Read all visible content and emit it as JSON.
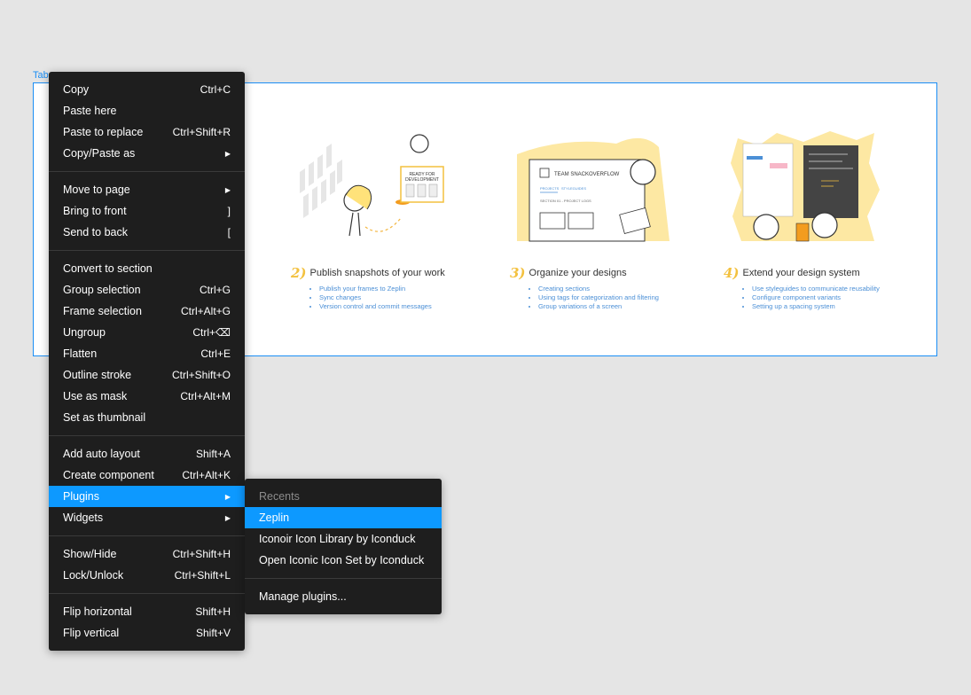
{
  "canvas": {
    "frame_label": "Tab",
    "columns": [
      {
        "num": "2)",
        "title": "Publish snapshots of your work",
        "bullets": [
          "Publish your frames to Zeplin",
          "Sync changes",
          "Version control and commit messages"
        ],
        "art_text": [
          "READY FOR",
          "DEVELOPMENT"
        ]
      },
      {
        "num": "3)",
        "title": "Organize your designs",
        "bullets": [
          "Creating sections",
          "Using tags for categorization and filtering",
          "Group variations of a screen"
        ],
        "art_text": [
          "TEAM SNACKOVERFLOW",
          "PROJECTS",
          "STYLEGUIDES",
          "SECTION 01 - PROJECT LOGS"
        ]
      },
      {
        "num": "4)",
        "title": "Extend your design system",
        "bullets": [
          "Use styleguides to communicate reusability",
          "Configure component variants",
          "Setting up a spacing system"
        ],
        "art_text": []
      }
    ]
  },
  "menu": {
    "groups": [
      [
        {
          "label": "Copy",
          "shortcut": "Ctrl+C"
        },
        {
          "label": "Paste here",
          "shortcut": ""
        },
        {
          "label": "Paste to replace",
          "shortcut": "Ctrl+Shift+R"
        },
        {
          "label": "Copy/Paste as",
          "shortcut": "",
          "submenu": true
        }
      ],
      [
        {
          "label": "Move to page",
          "shortcut": "",
          "submenu": true
        },
        {
          "label": "Bring to front",
          "shortcut": "]"
        },
        {
          "label": "Send to back",
          "shortcut": "["
        }
      ],
      [
        {
          "label": "Convert to section",
          "shortcut": ""
        },
        {
          "label": "Group selection",
          "shortcut": "Ctrl+G"
        },
        {
          "label": "Frame selection",
          "shortcut": "Ctrl+Alt+G"
        },
        {
          "label": "Ungroup",
          "shortcut": "Ctrl+⌫"
        },
        {
          "label": "Flatten",
          "shortcut": "Ctrl+E"
        },
        {
          "label": "Outline stroke",
          "shortcut": "Ctrl+Shift+O"
        },
        {
          "label": "Use as mask",
          "shortcut": "Ctrl+Alt+M"
        },
        {
          "label": "Set as thumbnail",
          "shortcut": ""
        }
      ],
      [
        {
          "label": "Add auto layout",
          "shortcut": "Shift+A"
        },
        {
          "label": "Create component",
          "shortcut": "Ctrl+Alt+K"
        },
        {
          "label": "Plugins",
          "shortcut": "",
          "submenu": true,
          "active": true
        },
        {
          "label": "Widgets",
          "shortcut": "",
          "submenu": true
        }
      ],
      [
        {
          "label": "Show/Hide",
          "shortcut": "Ctrl+Shift+H"
        },
        {
          "label": "Lock/Unlock",
          "shortcut": "Ctrl+Shift+L"
        }
      ],
      [
        {
          "label": "Flip horizontal",
          "shortcut": "Shift+H"
        },
        {
          "label": "Flip vertical",
          "shortcut": "Shift+V"
        }
      ]
    ]
  },
  "plugins_submenu": {
    "header": "Recents",
    "items": [
      {
        "label": "Zeplin",
        "active": true
      },
      {
        "label": "Iconoir Icon Library by Iconduck"
      },
      {
        "label": "Open Iconic Icon Set by Iconduck"
      }
    ],
    "manage": "Manage plugins..."
  },
  "colors": {
    "accent": "#0d99ff",
    "menu_bg": "#1e1e1e",
    "selection": "#1b8ef5",
    "illustration_yellow": "#fde8a3"
  }
}
